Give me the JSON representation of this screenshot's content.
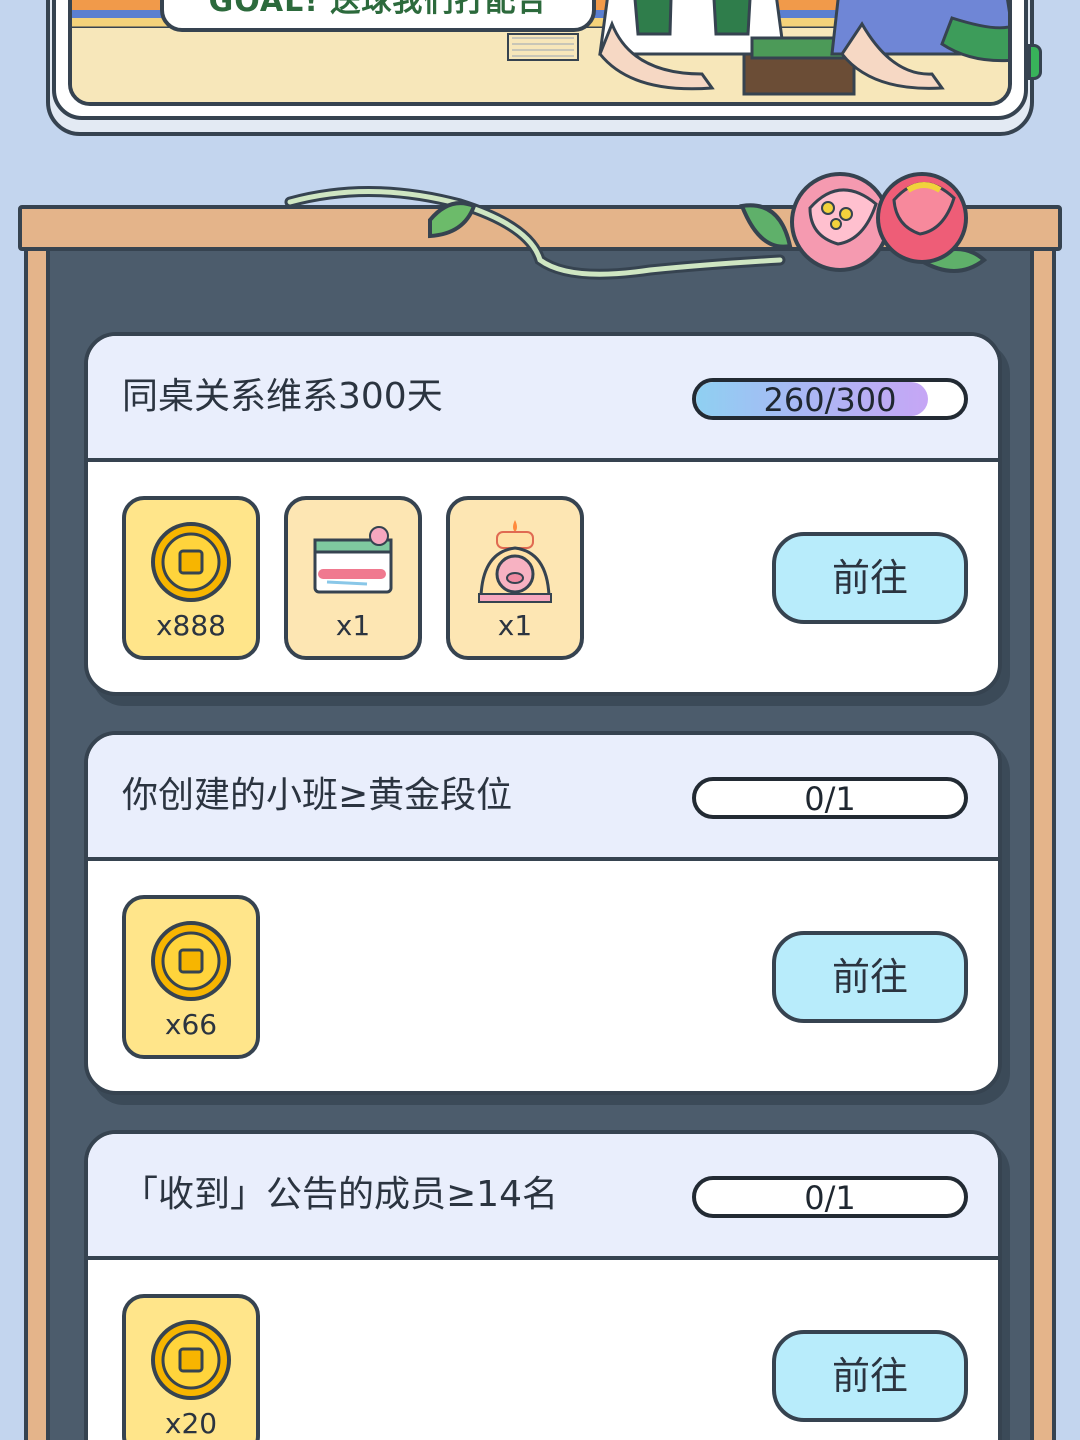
{
  "banner": {
    "title": "GOAL! 送球我们打配合"
  },
  "tasks": [
    {
      "title": "同桌关系维系300天",
      "progress_text": "260/300",
      "progress_fraction": 0.867,
      "rewards": [
        {
          "icon": "gold-coin-icon",
          "count": "x888"
        },
        {
          "icon": "300-days-calendar-icon",
          "count": "x1"
        },
        {
          "icon": "300-pig-cake-icon",
          "count": "x1"
        }
      ],
      "action_label": "前往"
    },
    {
      "title": "你创建的小班≥黄金段位",
      "progress_text": "0/1",
      "progress_fraction": 0,
      "rewards": [
        {
          "icon": "gold-coin-icon",
          "count": "x66"
        }
      ],
      "action_label": "前往"
    },
    {
      "title": "「收到」公告的成员≥14名",
      "progress_text": "0/1",
      "progress_fraction": 0,
      "rewards": [
        {
          "icon": "gold-coin-icon",
          "count": "x20"
        }
      ],
      "action_label": "前往"
    }
  ],
  "colors": {
    "page_background": "#c3d5ee",
    "board": "#4c5c6c",
    "frame_wood": "#e4b48a",
    "card_header": "#e9eefc",
    "coin_card": "#ffe58a",
    "item_card": "#fde6b3",
    "action_button": "#b8ecfb",
    "progress_fill_start": "#8fd0f2",
    "progress_fill_end": "#c6a6f5"
  }
}
